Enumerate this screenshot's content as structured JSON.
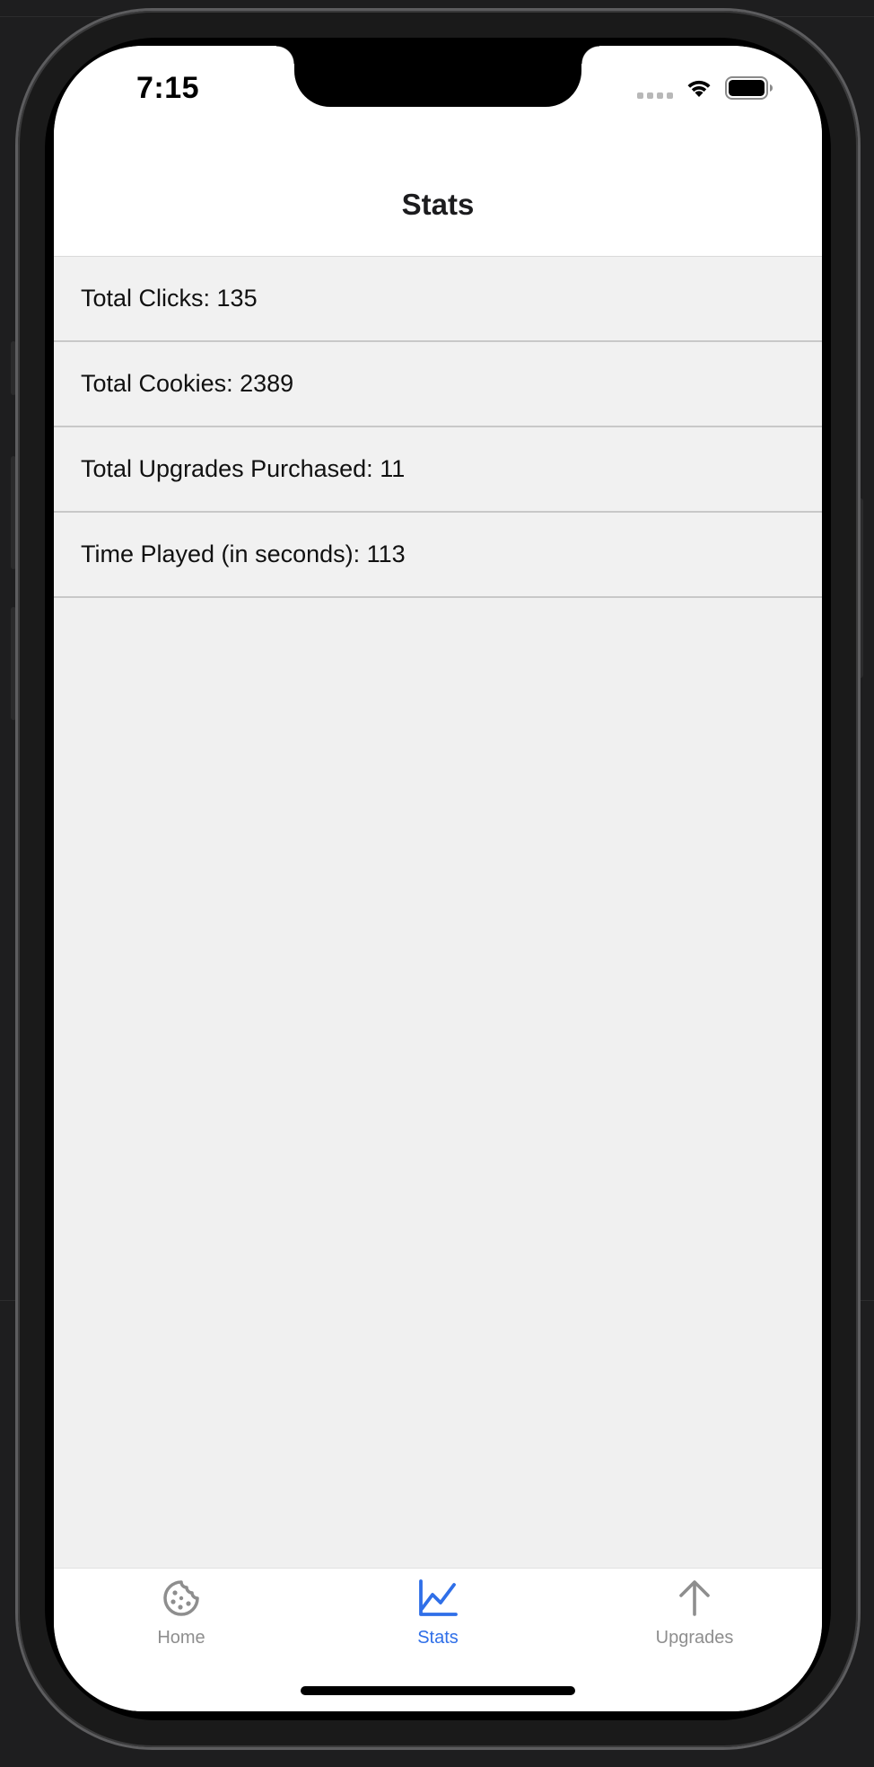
{
  "status_bar": {
    "time": "7:15",
    "icons": [
      "cellular-dots-icon",
      "wifi-icon",
      "battery-icon"
    ]
  },
  "nav": {
    "title": "Stats"
  },
  "stats": [
    {
      "label": "Total Clicks: 135"
    },
    {
      "label": "Total Cookies: 2389"
    },
    {
      "label": "Total Upgrades Purchased: 11"
    },
    {
      "label": "Time Played (in seconds): 113"
    }
  ],
  "tab_bar": {
    "tabs": [
      {
        "label": "Home",
        "icon": "cookie-icon",
        "active": false
      },
      {
        "label": "Stats",
        "icon": "chart-line-icon",
        "active": true
      },
      {
        "label": "Upgrades",
        "icon": "arrow-up-icon",
        "active": false
      }
    ]
  },
  "colors": {
    "active_tab": "#2f6fe8",
    "inactive_tab": "#8e8e8e",
    "list_background": "#f0f0f0",
    "header_background": "#ffffff"
  }
}
